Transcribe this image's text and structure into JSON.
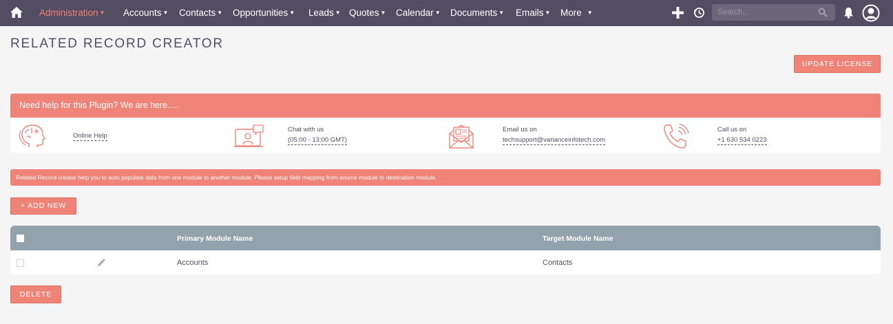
{
  "nav": {
    "items": [
      {
        "label": "Administration",
        "active": true
      },
      {
        "label": "Accounts"
      },
      {
        "label": "Contacts"
      },
      {
        "label": "Opportunities"
      },
      {
        "label": "Leads"
      },
      {
        "label": "Quotes"
      },
      {
        "label": "Calendar"
      },
      {
        "label": "Documents"
      },
      {
        "label": "Emails"
      },
      {
        "label": "More"
      }
    ],
    "search_placeholder": "Search...",
    "icons": [
      "home-icon",
      "plus-icon",
      "history-icon",
      "search-icon",
      "bell-icon",
      "user-avatar-icon"
    ]
  },
  "page": {
    "title": "RELATED RECORD CREATOR",
    "update_license_label": "UPDATE LICENSE"
  },
  "help": {
    "header": "Need help for this Plugin? We are here.....",
    "online_help": "Online Help",
    "chat_label": "Chat with us",
    "chat_hours": "(05:00 - 13:00 GMT)",
    "email_label": "Email us on",
    "email_address": "techsupport@varianceinfotech.com",
    "call_label": "Call us on",
    "call_number": "+1 630 534 0223"
  },
  "info_text": "Related Record creator help you to auto populate data from one module to another module. Please setup field mapping from source module to destination module.",
  "add_new_label": "+ ADD NEW",
  "table": {
    "columns": {
      "primary": "Primary Module Name",
      "target": "Target Module Name"
    },
    "rows": [
      {
        "primary": "Accounts",
        "target": "Contacts"
      }
    ]
  },
  "delete_label": "DELETE",
  "colors": {
    "nav_bg": "#534d64",
    "accent": "#f08377",
    "table_header": "#93a3ae"
  }
}
